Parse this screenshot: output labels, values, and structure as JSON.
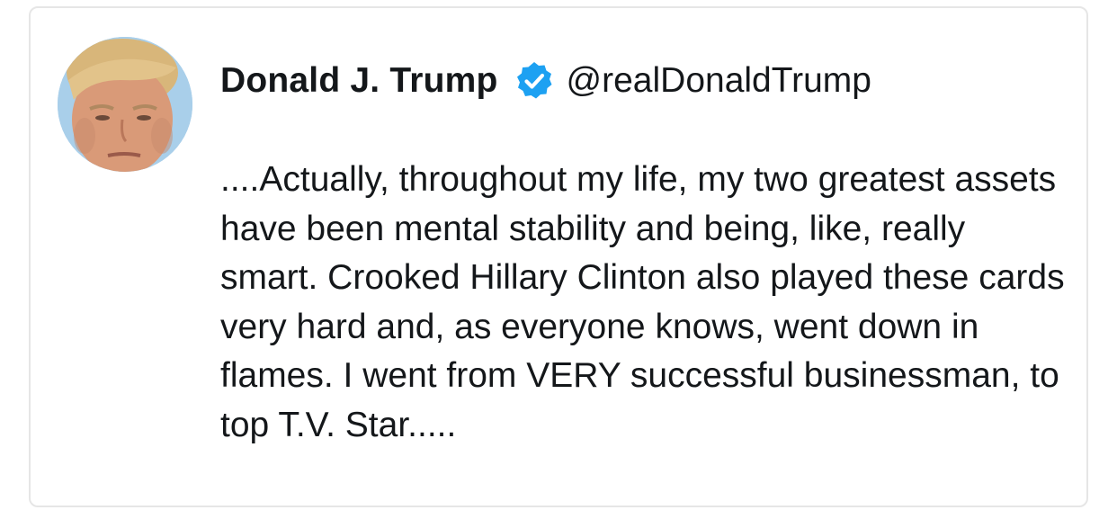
{
  "tweet": {
    "author": {
      "display_name": "Donald J. Trump",
      "handle": "@realDonaldTrump",
      "verified": true,
      "avatar_icon": "profile-photo",
      "verified_icon": "verified-badge-icon"
    },
    "text": "....Actually, throughout my life, my two greatest assets have been mental stability and being, like, really smart. Crooked Hillary Clinton also played these cards very hard and, as everyone knows, went down in flames. I went from VERY successful businessman, to top T.V. Star....."
  },
  "colors": {
    "text": "#14171a",
    "verified_blue": "#1da1f2",
    "card_border": "#e6e6e6",
    "background": "#ffffff"
  }
}
